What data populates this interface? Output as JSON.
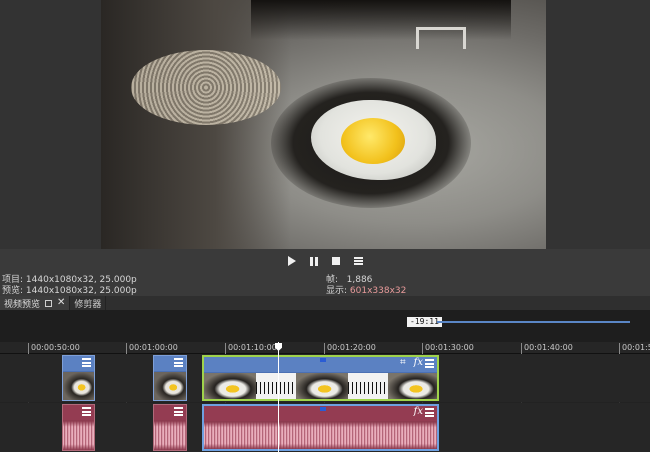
{
  "transport": {
    "play": "play-icon",
    "pause": "pause-icon",
    "stop": "stop-icon",
    "menu": "menu-icon"
  },
  "info": {
    "project_label": "项目:",
    "project_value": "1440x1080x32, 25.000p",
    "preview_label": "预览:",
    "preview_value": "1440x1080x32, 25.000p",
    "frame_label": "帧:",
    "frame_value": "1,886",
    "display_label": "显示:",
    "display_value": "601x338x32"
  },
  "tabs": [
    {
      "label": "视频预览"
    },
    {
      "label": "修剪器"
    }
  ],
  "timeline": {
    "cursor_time": "-19:11",
    "ticks": [
      "00:00:50:00",
      "00:01:00:00",
      "00:01:10:00",
      "00:01:20:00",
      "00:01:30:00",
      "00:01:40:00",
      "00:01:5"
    ]
  },
  "colors": {
    "video_clip": "#4b70b3",
    "audio_clip": "#8d3b4f",
    "selection": "#9fd34b",
    "display_value": "#e79a9a"
  }
}
